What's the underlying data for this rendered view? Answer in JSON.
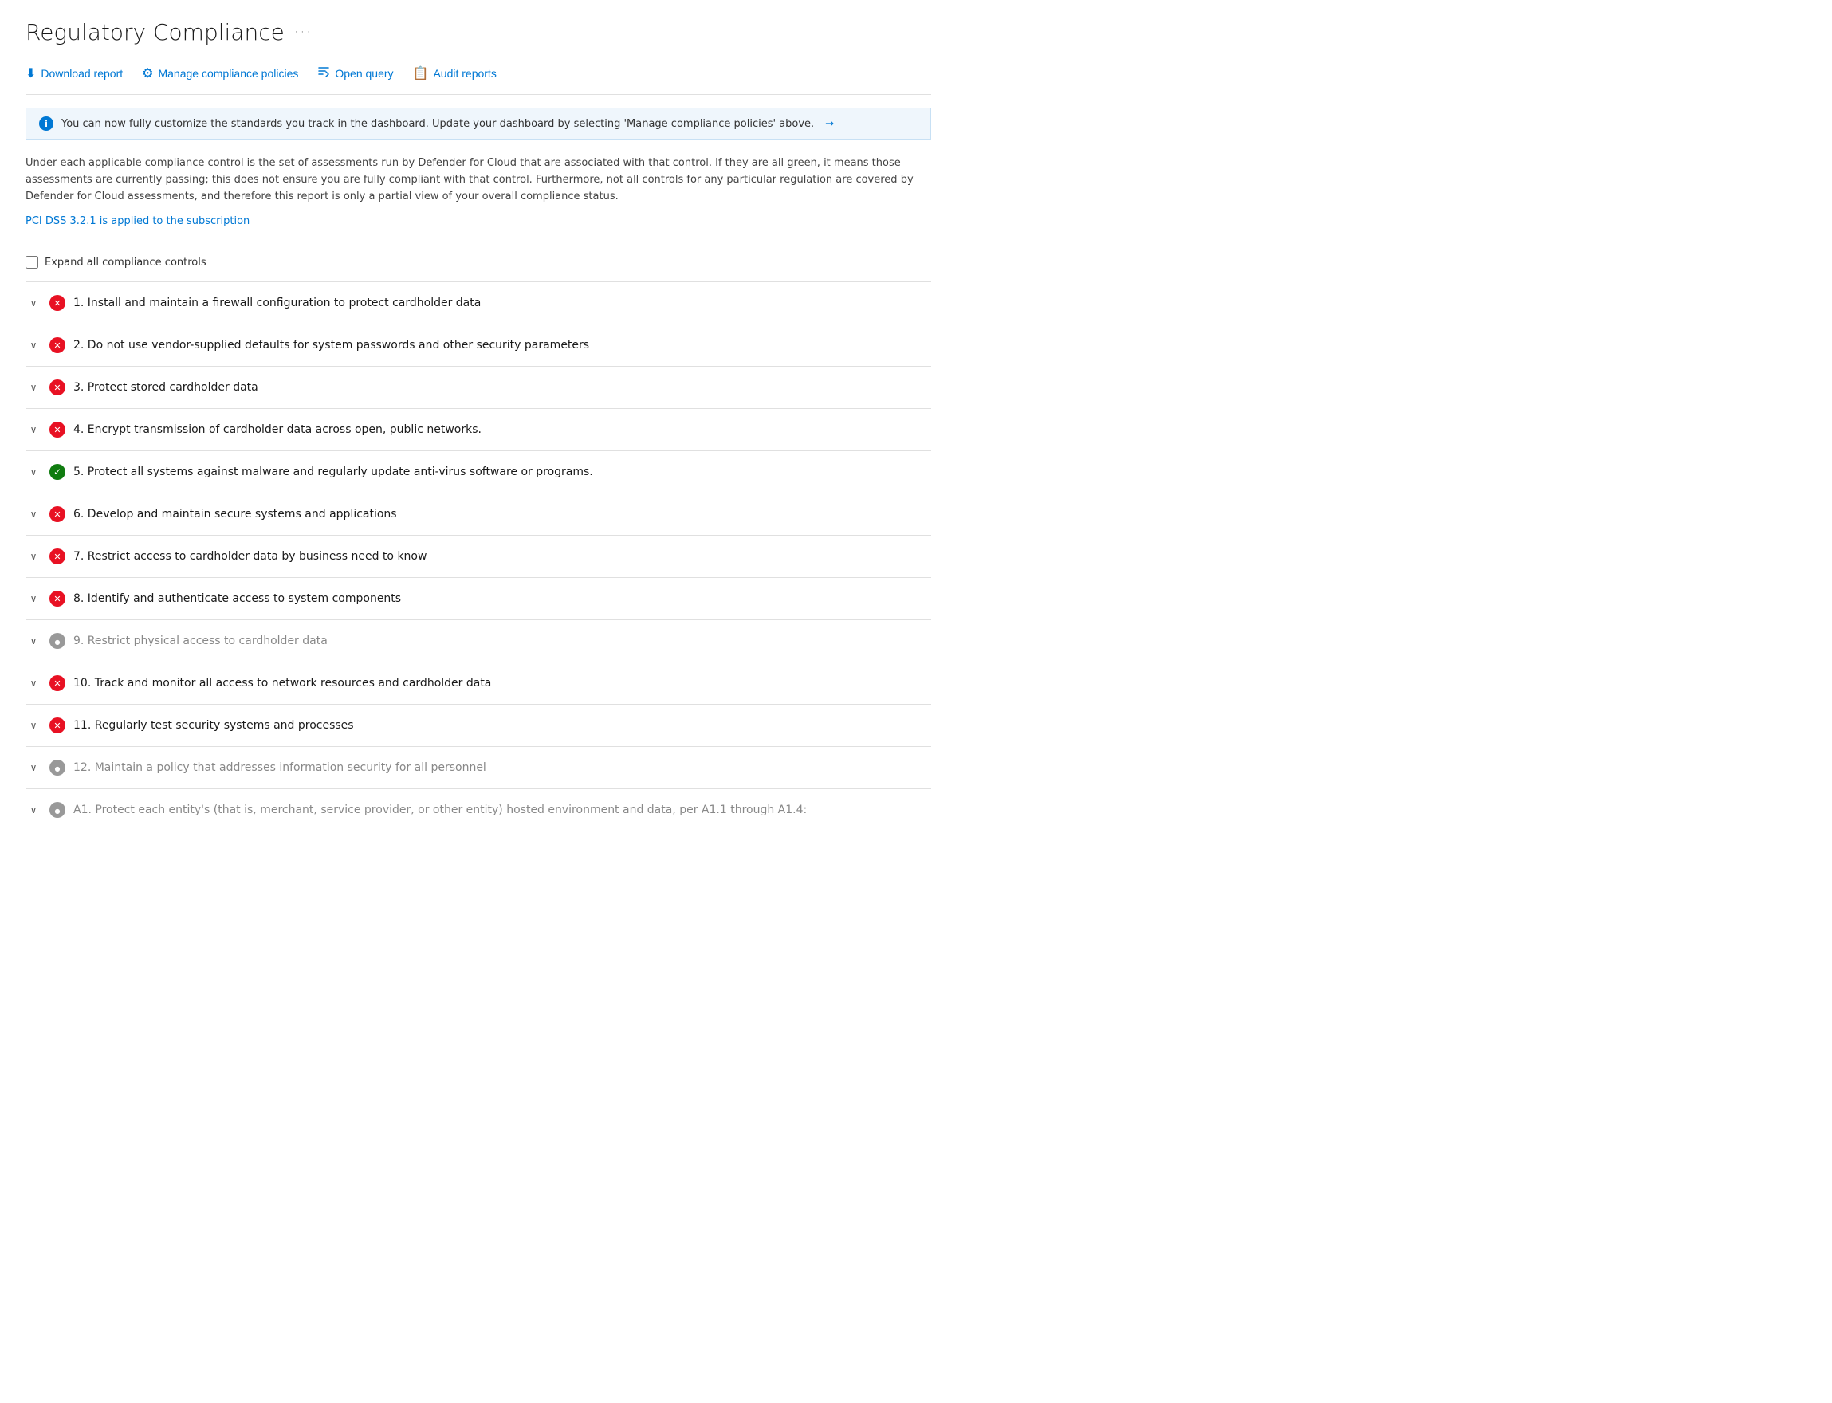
{
  "page": {
    "title": "Regulatory Compliance",
    "ellipsis": "···"
  },
  "toolbar": {
    "buttons": [
      {
        "id": "download-report",
        "label": "Download report",
        "icon": "⬇"
      },
      {
        "id": "manage-policies",
        "label": "Manage compliance policies",
        "icon": "⚙"
      },
      {
        "id": "open-query",
        "label": "Open query",
        "icon": "⟨⟩"
      },
      {
        "id": "audit-reports",
        "label": "Audit reports",
        "icon": "📋"
      }
    ]
  },
  "info_banner": {
    "text": "You can now fully customize the standards you track in the dashboard. Update your dashboard by selecting 'Manage compliance policies' above.",
    "arrow": "→"
  },
  "description": "Under each applicable compliance control is the set of assessments run by Defender for Cloud that are associated with that control. If they are all green, it means those assessments are currently passing; this does not ensure you are fully compliant with that control. Furthermore, not all controls for any particular regulation are covered by Defender for Cloud assessments, and therefore this report is only a partial view of your overall compliance status.",
  "subscription_link": "PCI DSS 3.2.1 is applied to the subscription",
  "expand_controls": {
    "label": "Expand all compliance controls"
  },
  "compliance_items": [
    {
      "id": 1,
      "title": "1. Install and maintain a firewall configuration to protect cardholder data",
      "status": "error",
      "grayed": false
    },
    {
      "id": 2,
      "title": "2. Do not use vendor-supplied defaults for system passwords and other security parameters",
      "status": "error",
      "grayed": false
    },
    {
      "id": 3,
      "title": "3. Protect stored cardholder data",
      "status": "error",
      "grayed": false
    },
    {
      "id": 4,
      "title": "4. Encrypt transmission of cardholder data across open, public networks.",
      "status": "error",
      "grayed": false
    },
    {
      "id": 5,
      "title": "5. Protect all systems against malware and regularly update anti-virus software or programs.",
      "status": "success",
      "grayed": false
    },
    {
      "id": 6,
      "title": "6. Develop and maintain secure systems and applications",
      "status": "error",
      "grayed": false
    },
    {
      "id": 7,
      "title": "7. Restrict access to cardholder data by business need to know",
      "status": "error",
      "grayed": false
    },
    {
      "id": 8,
      "title": "8. Identify and authenticate access to system components",
      "status": "error",
      "grayed": false
    },
    {
      "id": 9,
      "title": "9. Restrict physical access to cardholder data",
      "status": "neutral",
      "grayed": true
    },
    {
      "id": 10,
      "title": "10. Track and monitor all access to network resources and cardholder data",
      "status": "error",
      "grayed": false
    },
    {
      "id": 11,
      "title": "11. Regularly test security systems and processes",
      "status": "error",
      "grayed": false
    },
    {
      "id": 12,
      "title": "12. Maintain a policy that addresses information security for all personnel",
      "status": "neutral",
      "grayed": true
    },
    {
      "id": 13,
      "title": "A1. Protect each entity's (that is, merchant, service provider, or other entity) hosted environment and data, per A1.1 through A1.4:",
      "status": "neutral",
      "grayed": true
    }
  ]
}
